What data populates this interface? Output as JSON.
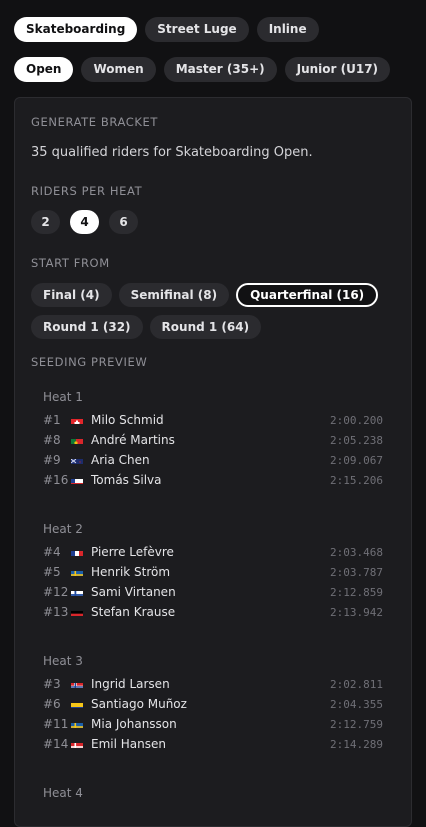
{
  "sports": [
    {
      "label": "Skateboarding",
      "active": true
    },
    {
      "label": "Street Luge",
      "active": false
    },
    {
      "label": "Inline",
      "active": false
    }
  ],
  "categories": [
    {
      "label": "Open",
      "active": true
    },
    {
      "label": "Women",
      "active": false
    },
    {
      "label": "Master (35+)",
      "active": false
    },
    {
      "label": "Junior (U17)",
      "active": false
    }
  ],
  "panel": {
    "title": "GENERATE BRACKET",
    "description": "35 qualified riders for Skateboarding Open.",
    "riders_label": "RIDERS PER HEAT",
    "riders_options": [
      "2",
      "4",
      "6"
    ],
    "riders_selected": "4",
    "start_label": "START FROM",
    "start_options": [
      {
        "label": "Final (4)",
        "active": false
      },
      {
        "label": "Semifinal (8)",
        "active": false
      },
      {
        "label": "Quarterfinal (16)",
        "active": true
      },
      {
        "label": "Round 1 (32)",
        "active": false
      },
      {
        "label": "Round 1 (64)",
        "active": false
      }
    ],
    "preview_label": "SEEDING PREVIEW"
  },
  "heats": [
    {
      "title": "Heat 1",
      "riders": [
        {
          "seed": "#1",
          "flag": "switzerland-flag",
          "name": "Milo Schmid",
          "time": "2:00.200"
        },
        {
          "seed": "#8",
          "flag": "portugal-flag",
          "name": "André Martins",
          "time": "2:05.238"
        },
        {
          "seed": "#9",
          "flag": "new-zealand-flag",
          "name": "Aria Chen",
          "time": "2:09.067"
        },
        {
          "seed": "#16",
          "flag": "chile-flag",
          "name": "Tomás Silva",
          "time": "2:15.206"
        }
      ]
    },
    {
      "title": "Heat 2",
      "riders": [
        {
          "seed": "#4",
          "flag": "france-flag",
          "name": "Pierre Lefèvre",
          "time": "2:03.468"
        },
        {
          "seed": "#5",
          "flag": "sweden-flag",
          "name": "Henrik Ström",
          "time": "2:03.787"
        },
        {
          "seed": "#12",
          "flag": "finland-flag",
          "name": "Sami Virtanen",
          "time": "2:12.859"
        },
        {
          "seed": "#13",
          "flag": "germany-flag",
          "name": "Stefan Krause",
          "time": "2:13.942"
        }
      ]
    },
    {
      "title": "Heat 3",
      "riders": [
        {
          "seed": "#3",
          "flag": "norway-flag",
          "name": "Ingrid Larsen",
          "time": "2:02.811"
        },
        {
          "seed": "#6",
          "flag": "colombia-flag",
          "name": "Santiago Muñoz",
          "time": "2:04.355"
        },
        {
          "seed": "#11",
          "flag": "sweden-flag",
          "name": "Mia Johansson",
          "time": "2:12.759"
        },
        {
          "seed": "#14",
          "flag": "denmark-flag",
          "name": "Emil Hansen",
          "time": "2:14.289"
        }
      ]
    },
    {
      "title": "Heat 4",
      "riders": []
    }
  ]
}
